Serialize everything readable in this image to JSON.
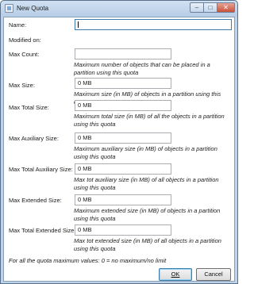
{
  "window": {
    "title": "New Quota",
    "controls": {
      "minimize_icon": "minimize-icon",
      "maximize_icon": "maximize-icon",
      "close_icon": "close-icon"
    }
  },
  "form": {
    "name": {
      "label": "Name:",
      "value": ""
    },
    "modified_on": {
      "label": "Modified on:",
      "value": ""
    },
    "max_count": {
      "label": "Max Count:",
      "value": "",
      "hint": "Maximum number of objects that can be placed in a partition using this quota"
    },
    "max_size": {
      "label": "Max Size:",
      "value": "0 MB",
      "hint": "Maximum size (in MB) of objects in a partition using this quota"
    },
    "max_total_size": {
      "label": "Max Total Size:",
      "value": "0 MB",
      "hint": "Maximum total size (in MB) of all the objects in a partition using this quota"
    },
    "max_auxiliary_size": {
      "label": "Max Auxiliary Size:",
      "value": "0 MB",
      "hint": "Maximum auxiliary size (in MB) of objects in a partition using this quota"
    },
    "max_total_auxiliary_size": {
      "label": "Max Total Auxiliary Size:",
      "value": "0 MB",
      "hint": "Max tot auxiliary size (in MB) of all objects in a partition using this quota"
    },
    "max_extended_size": {
      "label": "Max Extended Size:",
      "value": "0 MB",
      "hint": "Maximum extended size (in MB) of objects in a partition using this quota"
    },
    "max_total_extended_size": {
      "label": "Max Total Extended Size:",
      "value": "0 MB",
      "hint": "Max tot extended size (in MB) of all objects in a partition using this quota"
    }
  },
  "footer": {
    "note": "For all the quota maximum values: 0 = no maximum/no limit",
    "ok_label": "OK",
    "cancel_label": "Cancel"
  }
}
